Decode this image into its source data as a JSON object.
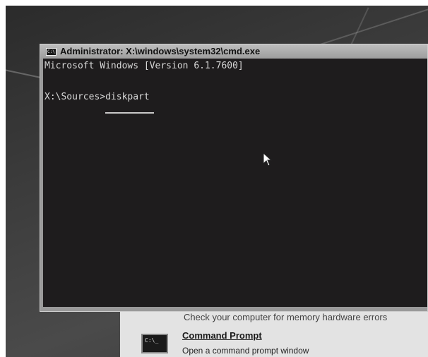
{
  "window": {
    "title": "Administrator: X:\\windows\\system32\\cmd.exe",
    "icon_text": "C:\\"
  },
  "console": {
    "lines": [
      "Microsoft Windows [Version 6.1.7600]"
    ],
    "prompt": "X:\\Sources>",
    "command": "diskpart"
  },
  "recovery": {
    "obscured_text": "Check your computer for memory hardware errors",
    "item_title": "Command Prompt",
    "item_desc": "Open a command prompt window",
    "item_icon_text": "C:\\_"
  }
}
